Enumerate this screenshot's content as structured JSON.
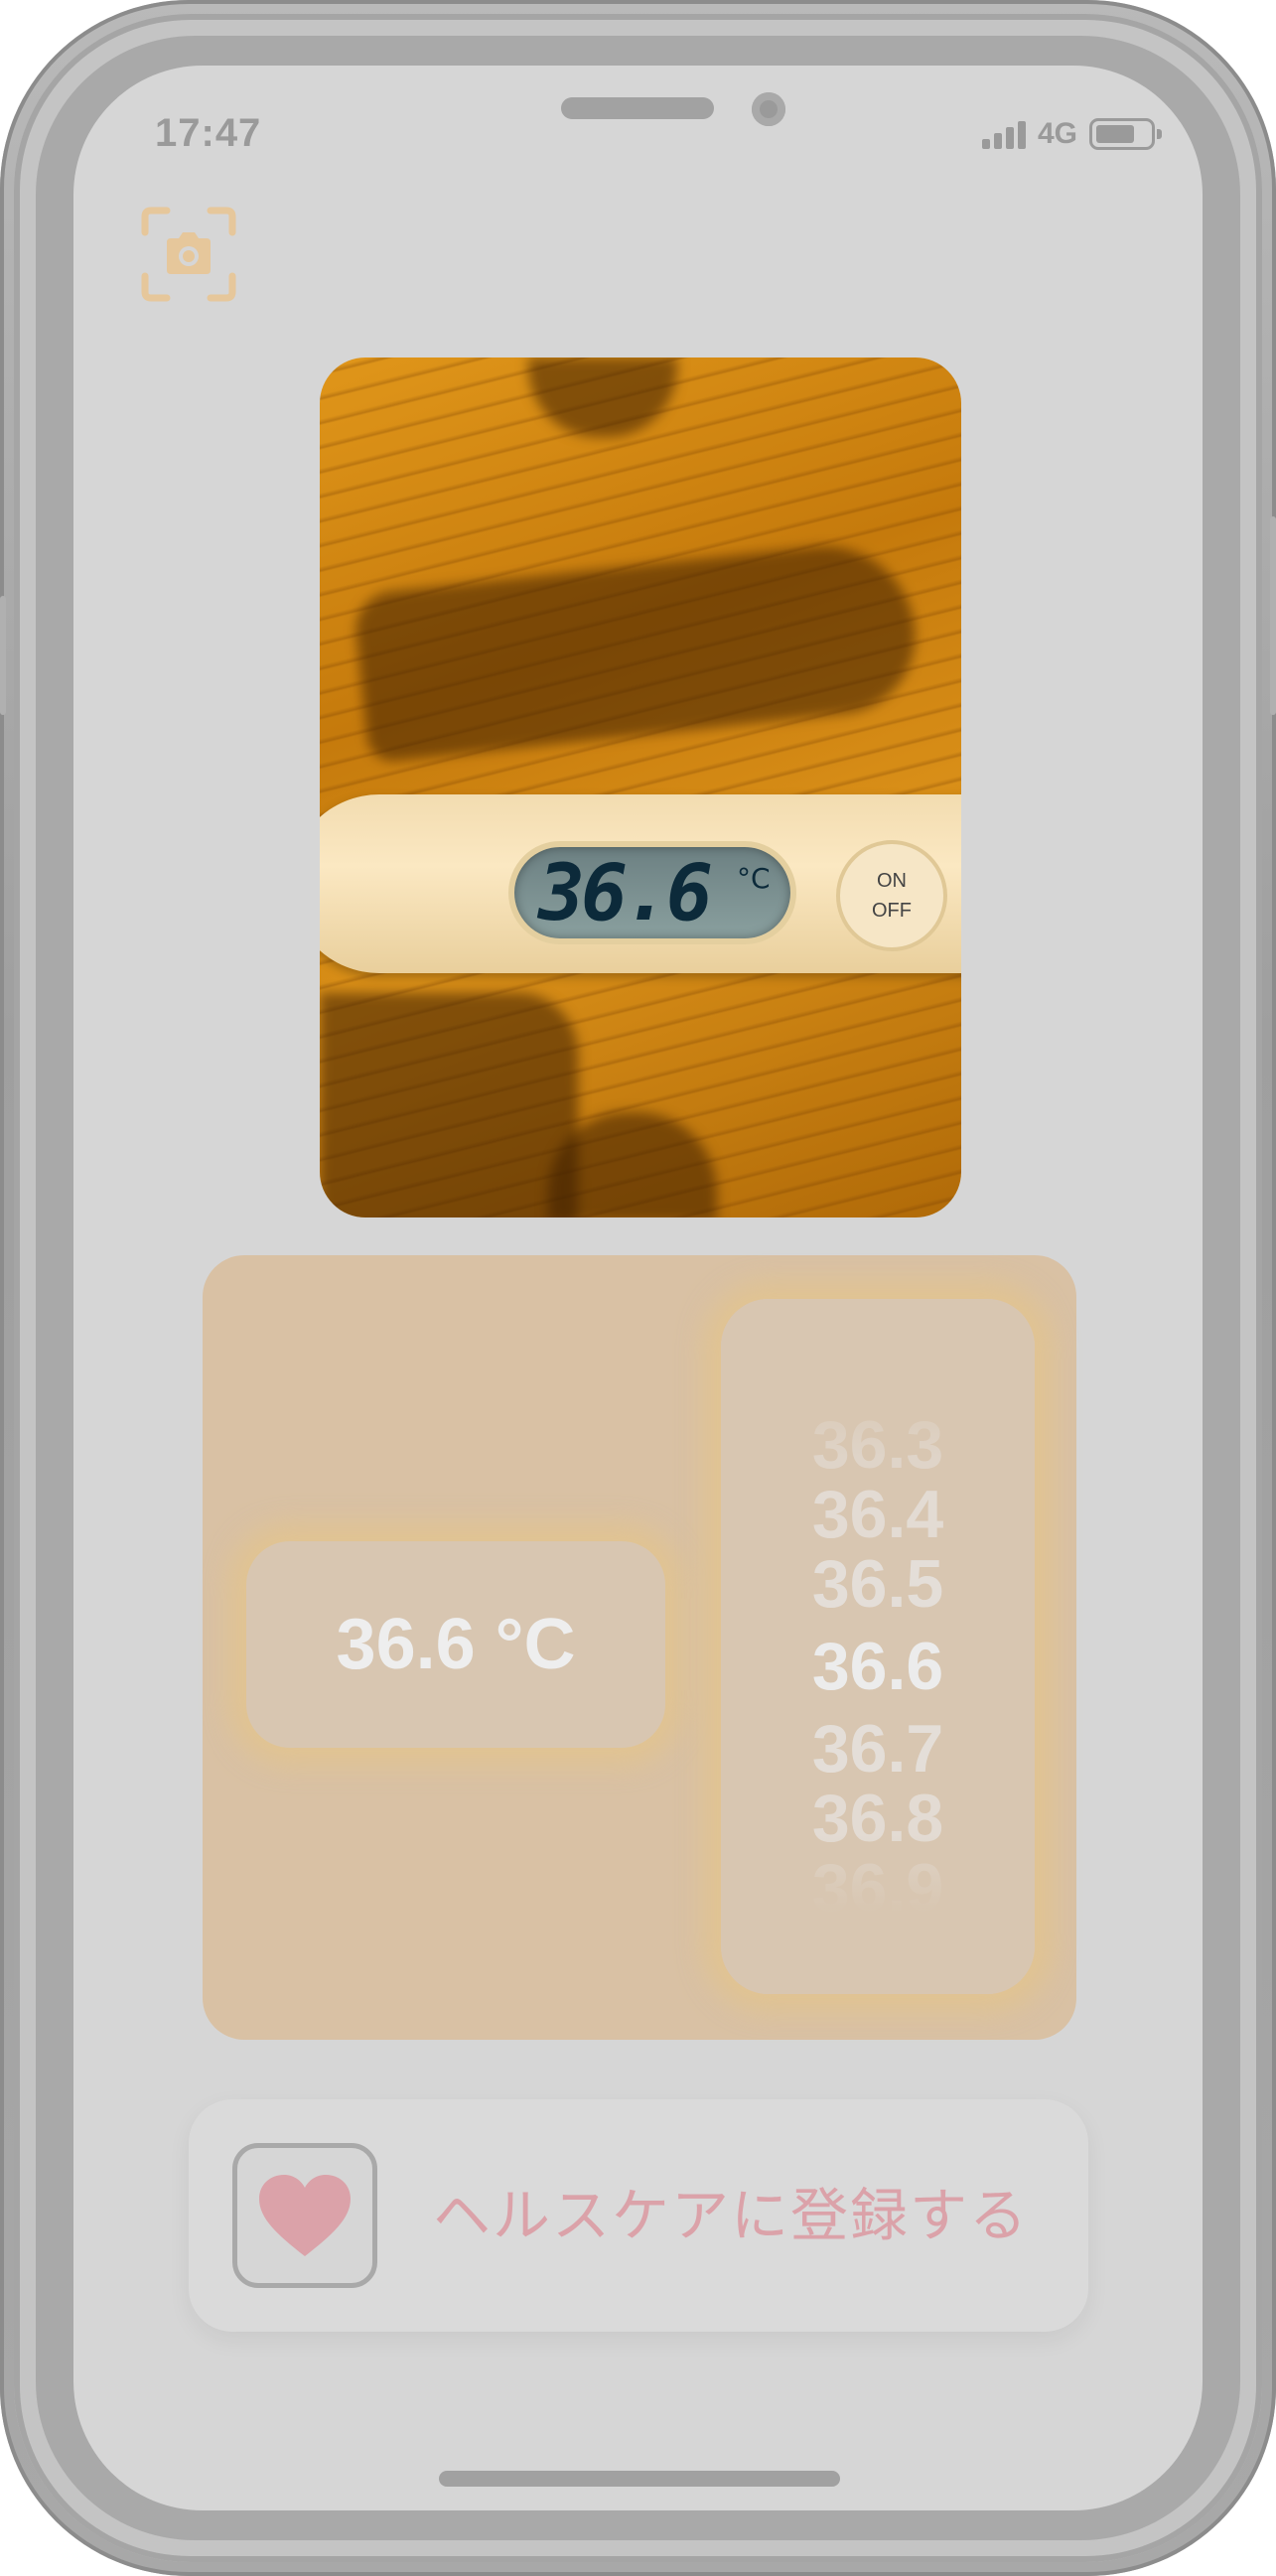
{
  "status_bar": {
    "time": "17:47",
    "network": "4G",
    "battery_level": 0.6
  },
  "toolbar": {
    "scan_icon": "camera-scan-icon",
    "accent_color": "#e6c79b"
  },
  "photo": {
    "display_reading": "36.6",
    "display_unit": "°C",
    "button_on": "ON",
    "button_off": "OFF"
  },
  "reading": {
    "value_text": "36.6 °C",
    "picker": {
      "options": [
        "36.3",
        "36.4",
        "36.5",
        "36.6",
        "36.7",
        "36.8",
        "36.9"
      ],
      "selected": "36.6"
    }
  },
  "health": {
    "label": "ヘルスケアに登録する",
    "icon": "heart-icon",
    "color": "#dba2a9"
  }
}
